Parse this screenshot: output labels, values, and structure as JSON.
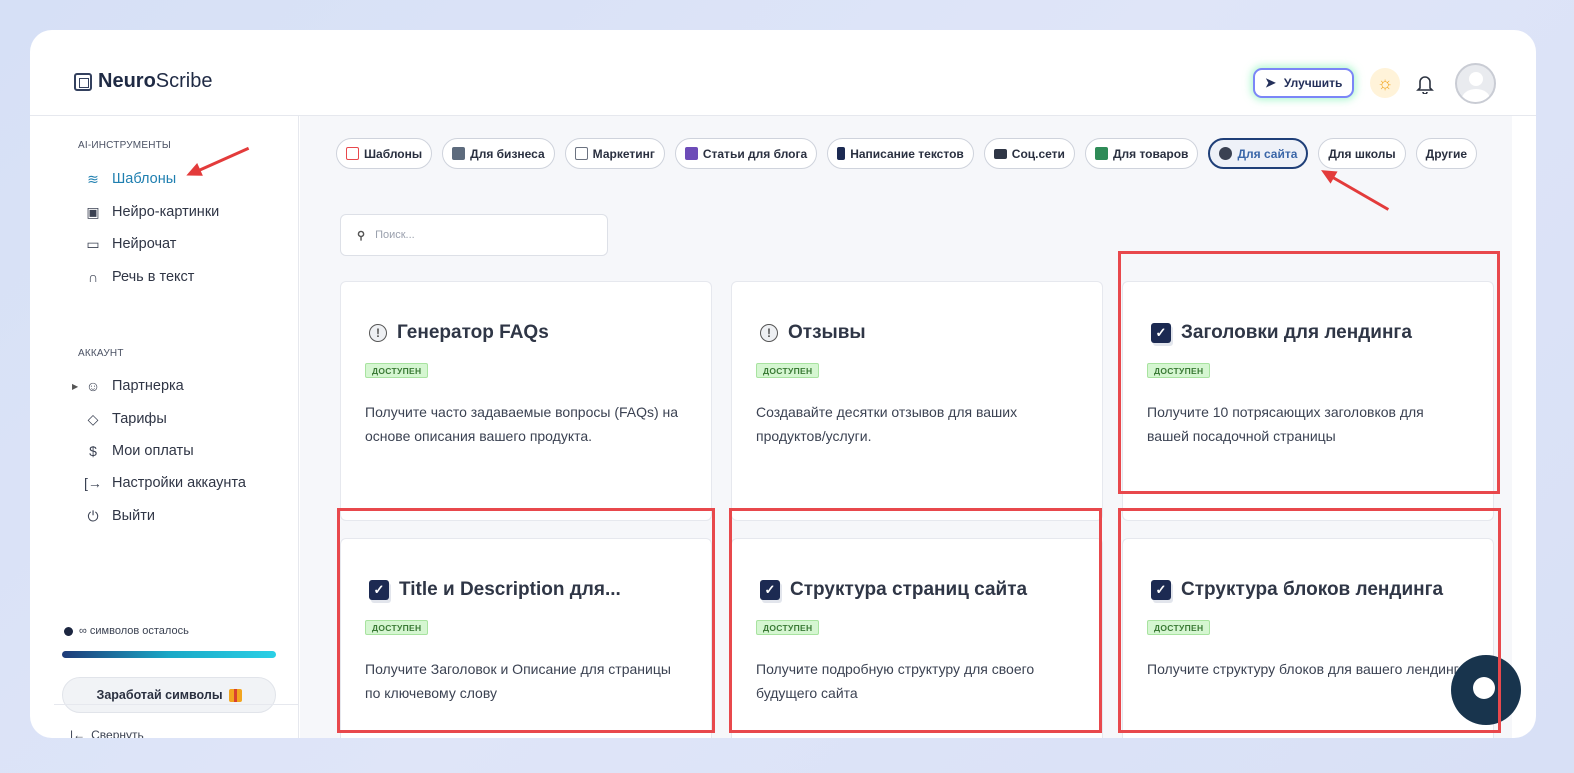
{
  "brand": {
    "name_bold": "Neuro",
    "name_rest": "Scribe"
  },
  "header": {
    "upgrade_label": "Улучшить"
  },
  "sidebar": {
    "tools_label": "AI-ИНСТРУМЕНТЫ",
    "tools": [
      {
        "label": "Шаблоны",
        "icon": "layers-icon"
      },
      {
        "label": "Нейро-картинки",
        "icon": "image-icon"
      },
      {
        "label": "Нейрочат",
        "icon": "chat-icon"
      },
      {
        "label": "Речь в текст",
        "icon": "headphones-icon"
      }
    ],
    "account_label": "АККАУНТ",
    "account": [
      {
        "label": "Партнерка",
        "icon": "users-icon"
      },
      {
        "label": "Тарифы",
        "icon": "tag-icon"
      },
      {
        "label": "Мои оплаты",
        "icon": "dollar-icon"
      },
      {
        "label": "Настройки аккаунта",
        "icon": "logout-icon"
      },
      {
        "label": "Выйти",
        "icon": "power-icon"
      }
    ],
    "symbols_text": "∞ символов осталось",
    "earn_label": "Заработай символы",
    "collapse_label": "Свернуть"
  },
  "chips": [
    {
      "label": "Шаблоны",
      "color": "#e8484c"
    },
    {
      "label": "Для бизнеса",
      "color": "#5d6b7d"
    },
    {
      "label": "Маркетинг",
      "color": "#6b7280"
    },
    {
      "label": "Статьи для блога",
      "color": "#6d4cb8"
    },
    {
      "label": "Написание текстов",
      "color": "#1c2a52"
    },
    {
      "label": "Соц.сети",
      "color": "#2f3646"
    },
    {
      "label": "Для товаров",
      "color": "#2e8b57"
    },
    {
      "label": "Для сайта",
      "color": "#3a4152"
    },
    {
      "label": "Для школы",
      "color": ""
    },
    {
      "label": "Другие",
      "color": ""
    }
  ],
  "search": {
    "placeholder": "Поиск..."
  },
  "cards": [
    {
      "title": "Генератор FAQs",
      "badge": "ДОСТУПЕН",
      "desc": "Получите часто задаваемые вопросы (FAQs) на основе описания вашего продукта.",
      "icon": "info-icon"
    },
    {
      "title": "Отзывы",
      "badge": "ДОСТУПЕН",
      "desc": "Создавайте десятки отзывов для ваших продуктов/услуги.",
      "icon": "info-icon"
    },
    {
      "title": "Заголовки для лендинга",
      "badge": "ДОСТУПЕН",
      "desc": "Получите 10 потрясающих заголовков для вашей посадочной страницы",
      "icon": "checkbox-icon"
    },
    {
      "title": "Title и Description для...",
      "badge": "ДОСТУПЕН",
      "desc": "Получите Заголовок и Описание для страницы по ключевому слову",
      "icon": "checkbox-icon"
    },
    {
      "title": "Структура страниц сайта",
      "badge": "ДОСТУПЕН",
      "desc": "Получите подробную структуру для своего будущего сайта",
      "icon": "checkbox-icon"
    },
    {
      "title": "Структура блоков лендинга",
      "badge": "ДОСТУПЕН",
      "desc": "Получите структуру блоков для вашего лендинга",
      "icon": "checkbox-icon"
    }
  ],
  "annotation_color": "#e33b3b"
}
